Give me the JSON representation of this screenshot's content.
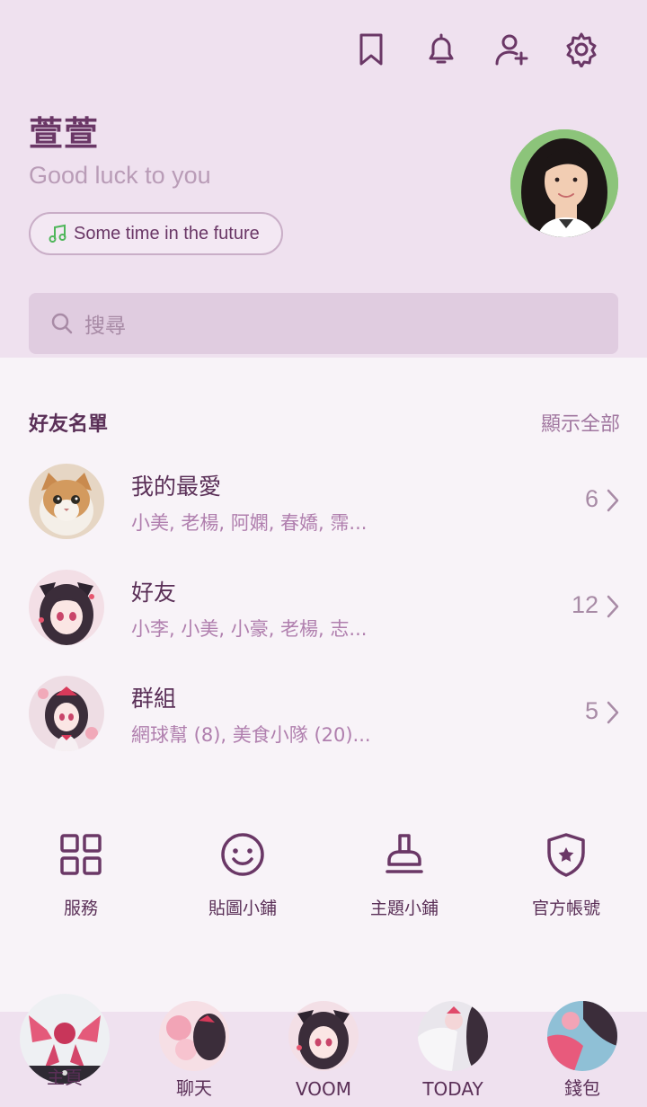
{
  "profile": {
    "name": "萱萱",
    "status": "Good luck to you",
    "music": "Some time in the future"
  },
  "search": {
    "placeholder": "搜尋"
  },
  "friends": {
    "title": "好友名單",
    "show_all": "顯示全部",
    "rows": [
      {
        "title": "我的最愛",
        "sub": "小美, 老楊, 阿嫻, 春嬌, 霈...",
        "count": "6"
      },
      {
        "title": "好友",
        "sub": "小李, 小美, 小豪, 老楊, 志...",
        "count": "12"
      },
      {
        "title": "群組",
        "sub": "網球幫 (8), 美食小隊 (20)...",
        "count": "5"
      }
    ]
  },
  "services": [
    {
      "label": "服務",
      "icon": "grid-icon"
    },
    {
      "label": "貼圖小鋪",
      "icon": "smiley-icon"
    },
    {
      "label": "主題小鋪",
      "icon": "brush-icon"
    },
    {
      "label": "官方帳號",
      "icon": "shield-star-icon"
    }
  ],
  "tabs": [
    {
      "label": "主頁"
    },
    {
      "label": "聊天"
    },
    {
      "label": "VOOM"
    },
    {
      "label": "TODAY"
    },
    {
      "label": "錢包"
    }
  ],
  "colors": {
    "accent": "#6a3766",
    "header_bg": "#efe1ef",
    "page_bg": "#f8f3f8",
    "search_bg": "#e0cce0"
  }
}
